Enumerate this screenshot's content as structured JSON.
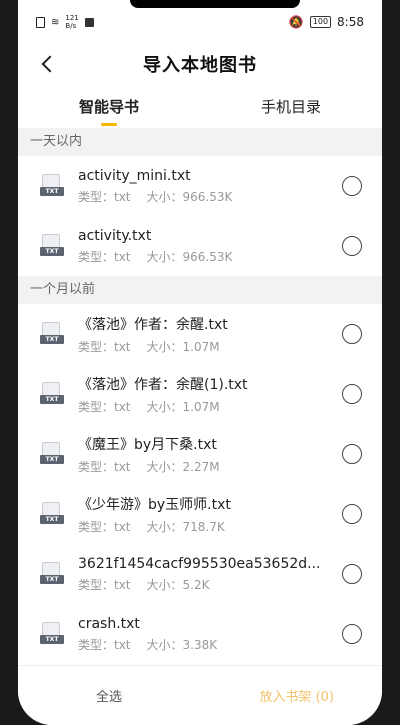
{
  "status": {
    "speed_value": "121",
    "speed_unit": "B/s",
    "battery": "100",
    "time": "8:58"
  },
  "header": {
    "title": "导入本地图书"
  },
  "tabs": [
    {
      "label": "智能导书"
    },
    {
      "label": "手机目录"
    }
  ],
  "sections": [
    {
      "label": "一天以内"
    },
    {
      "label": "一个月以前"
    }
  ],
  "files": [
    {
      "name": "activity_mini.txt",
      "type": "类型：txt",
      "size": "大小：966.53K"
    },
    {
      "name": "activity.txt",
      "type": "类型：txt",
      "size": "大小：966.53K"
    },
    {
      "name": "《落池》作者：余醒.txt",
      "type": "类型：txt",
      "size": "大小：1.07M"
    },
    {
      "name": "《落池》作者：余醒(1).txt",
      "type": "类型：txt",
      "size": "大小：1.07M"
    },
    {
      "name": "《魔王》by月下桑.txt",
      "type": "类型：txt",
      "size": "大小：2.27M"
    },
    {
      "name": "《少年游》by玉师师.txt",
      "type": "类型：txt",
      "size": "大小：718.7K"
    },
    {
      "name": "3621f1454cacf995530ea53652d...",
      "type": "类型：txt",
      "size": "大小：5.2K"
    },
    {
      "name": "crash.txt",
      "type": "类型：txt",
      "size": "大小：3.38K"
    }
  ],
  "file_icon_label": "TXT",
  "footer": {
    "select_all": "全选",
    "confirm": "放入书架 (0)"
  },
  "colors": {
    "accent": "#f5b700",
    "confirm_disabled": "#f1c36b"
  }
}
